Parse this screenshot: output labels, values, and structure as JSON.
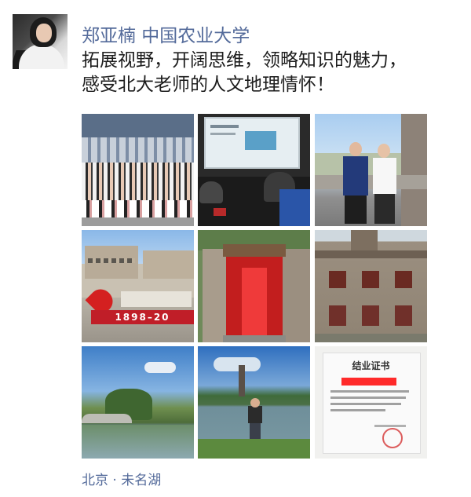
{
  "post": {
    "author": "郑亚楠  中国农业大学",
    "text_lines": [
      "拓展视野，开阔思维，领略知识的魅力，",
      "感受北大老师的人文地理情怀！"
    ],
    "location": "北京 · 未名湖"
  },
  "photos": {
    "p5_sign": "1898–20",
    "p9_title": "结业证书"
  },
  "colors": {
    "name": "#536a9a",
    "text": "#1d1d1d",
    "location": "#536a9a"
  }
}
